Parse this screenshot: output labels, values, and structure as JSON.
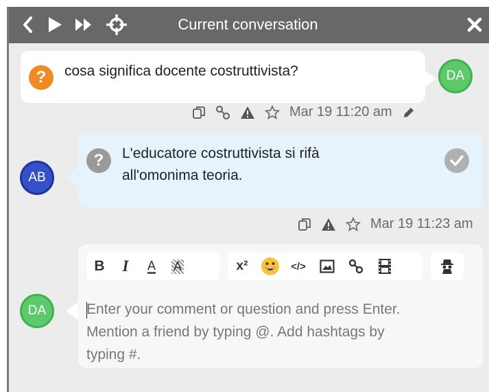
{
  "header": {
    "title": "Current conversation",
    "icons": [
      "chevron-left-icon",
      "play-icon",
      "fast-forward-icon",
      "crosshair-icon",
      "close-icon"
    ]
  },
  "messages": [
    {
      "avatar": "DA",
      "text": "cosa significa docente costruttivista?",
      "timestamp": "Mar 19 11:20 am",
      "status_icon": "question-icon"
    },
    {
      "avatar": "AB",
      "text_line1": "L'educatore costruttivista si rifà",
      "text_line2": "all'omonima teoria.",
      "timestamp": "Mar 19 11:23 am",
      "status_icon": "question-icon"
    }
  ],
  "composer": {
    "avatar": "DA",
    "placeholder_line1": "Enter your comment or question and press Enter.",
    "placeholder_line2": "Mention a friend by typing @. Add hashtags by",
    "placeholder_line3": "typing #.",
    "toolbar": {
      "bold": "B",
      "italic": "I",
      "font_color": "A",
      "highlight": "A",
      "superscript": "x²",
      "emoji": "😀",
      "code": "</>"
    }
  },
  "colors": {
    "header_bg": "#686868",
    "question_orange": "#f08a24",
    "green_avatar": "#5cc96a",
    "blue_avatar": "#3550c9",
    "reply_bubble": "#e6f3fd"
  }
}
